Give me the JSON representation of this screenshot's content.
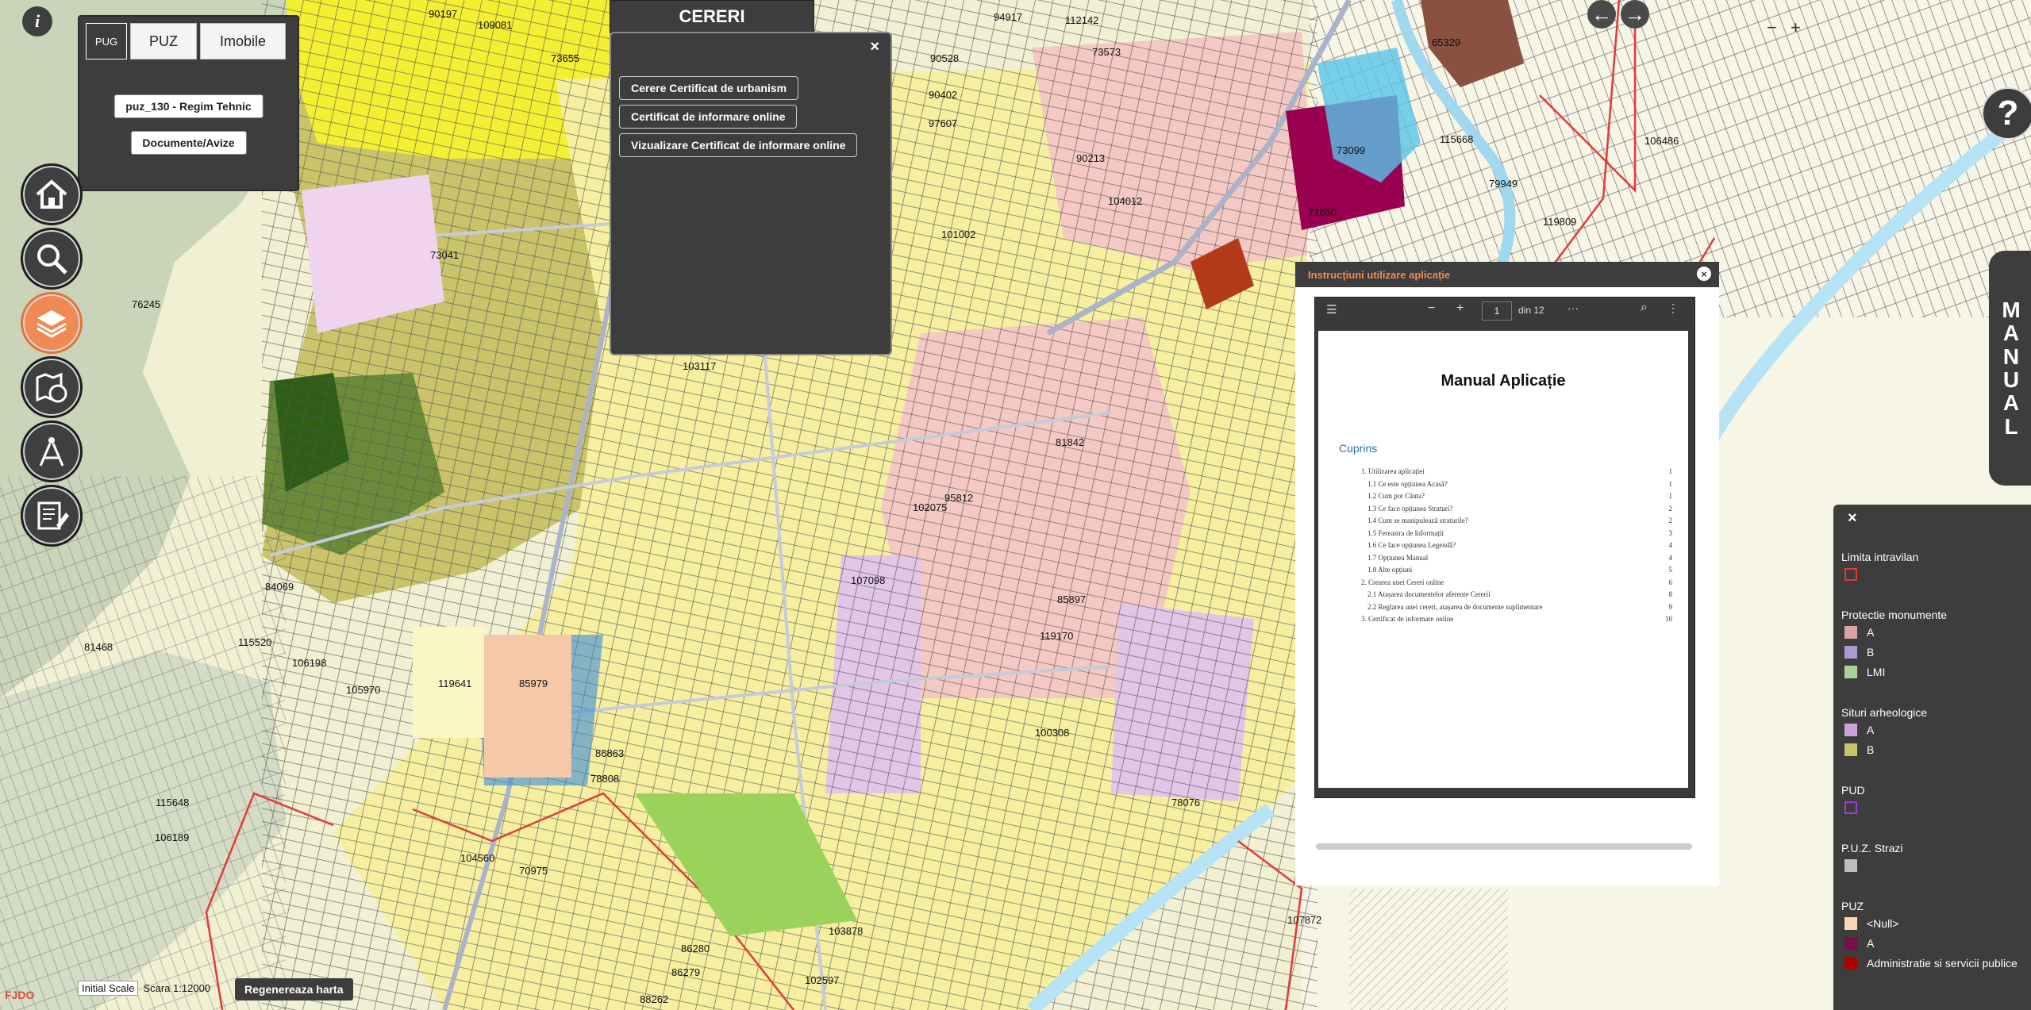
{
  "info_button": {
    "label": "i"
  },
  "tab_panel": {
    "tabs": [
      {
        "label": "PUG",
        "active": true
      },
      {
        "label": "PUZ",
        "active": false
      },
      {
        "label": "Imobile",
        "active": false
      }
    ],
    "buttons": [
      {
        "label": "puz_130 - Regim Tehnic"
      },
      {
        "label": "Documente/Avize"
      }
    ]
  },
  "left_toolbar": {
    "buttons": [
      {
        "icon": "home-icon",
        "active": false
      },
      {
        "icon": "search-icon",
        "active": false
      },
      {
        "icon": "layers-icon",
        "active": true
      },
      {
        "icon": "map-globe-icon",
        "active": false
      },
      {
        "icon": "compass-drafting-icon",
        "active": false
      },
      {
        "icon": "edit-document-icon",
        "active": false
      }
    ]
  },
  "cereri": {
    "title": "CERERI",
    "close_label": "×",
    "buttons": [
      {
        "label": "Cerere Certificat de urbanism"
      },
      {
        "label": "Certificat de informare online"
      },
      {
        "label": "Vizualizare Certificat de informare online"
      }
    ]
  },
  "nav": {
    "zoom_out": "−",
    "zoom_in": "+",
    "back": "←",
    "forward": "→"
  },
  "help_button": {
    "label": "?"
  },
  "manual_tab": {
    "label": "MANUAL"
  },
  "doc_window": {
    "title": "Instrucțiuni utilizare aplicație",
    "close_label": "×",
    "pdf_toolbar": {
      "page": "1",
      "total": "din 12",
      "zoom_out": "−",
      "zoom_in": "+",
      "more": "···"
    },
    "pdf_title": "Manual Aplicație",
    "toc_heading": "Cuprins",
    "toc": [
      {
        "text": "1. Utilizarea aplicației",
        "page": "1",
        "indent": 0
      },
      {
        "text": "1.1 Ce este opțiunea Acasă?",
        "page": "1",
        "indent": 1
      },
      {
        "text": "1.2 Cum pot Căuta?",
        "page": "1",
        "indent": 1
      },
      {
        "text": "1.3 Ce face opțiunea Straturi?",
        "page": "2",
        "indent": 1
      },
      {
        "text": "1.4 Cum se manipulează straturile?",
        "page": "2",
        "indent": 1
      },
      {
        "text": "1.5 Fereastra de Informații",
        "page": "3",
        "indent": 1
      },
      {
        "text": "1.6 Ce face opțiunea Legendă?",
        "page": "4",
        "indent": 1
      },
      {
        "text": "1.7 Opțiunea Manual",
        "page": "4",
        "indent": 1
      },
      {
        "text": "1.8 Alte opțiuni",
        "page": "5",
        "indent": 1
      },
      {
        "text": "2. Crearea unei Cereri online",
        "page": "6",
        "indent": 0
      },
      {
        "text": "2.1 Atașarea documentelor aferente Cererii",
        "page": "8",
        "indent": 1
      },
      {
        "text": "2.2 Reglarea unei cereri, atașarea de documente suplimentare",
        "page": "9",
        "indent": 1
      },
      {
        "text": "3. Certificat de informare online",
        "page": "10",
        "indent": 0
      }
    ]
  },
  "legend": {
    "close_label": "×",
    "groups": [
      {
        "title": "Limita intravilan",
        "items": [
          {
            "label": "",
            "color": "#e23a3a",
            "style": "outline"
          }
        ]
      },
      {
        "title": "Protectie monumente",
        "items": [
          {
            "label": "A",
            "color": "#d9a3a3",
            "style": "fill"
          },
          {
            "label": "B",
            "color": "#a99ad3",
            "style": "fill"
          },
          {
            "label": "LMI",
            "color": "#a9d39a",
            "style": "fill"
          }
        ]
      },
      {
        "title": "Situri arheologice",
        "items": [
          {
            "label": "A",
            "color": "#c9a3d9",
            "style": "fill"
          },
          {
            "label": "B",
            "color": "#c9c36a",
            "style": "fill"
          }
        ]
      },
      {
        "title": "PUD",
        "items": [
          {
            "label": "",
            "color": "#9a3dd9",
            "style": "outline"
          }
        ]
      },
      {
        "title": "P.U.Z. Strazi",
        "items": [
          {
            "label": "",
            "color": "#bdbdbd",
            "style": "fill"
          }
        ]
      },
      {
        "title": "PUZ",
        "items": [
          {
            "label": "<Null>",
            "color": "#f6d8b4",
            "style": "fill"
          },
          {
            "label": "A",
            "color": "#7a0e4a",
            "style": "fill"
          },
          {
            "label": "Administratie si servicii publice",
            "color": "#b00000",
            "style": "fill"
          }
        ]
      }
    ]
  },
  "bottom_bar": {
    "scale_select": "Initial Scale",
    "scale_text": "Scara 1:12000",
    "regen_label": "Regenereaza harta",
    "logo": "FJDO"
  },
  "map": {
    "colors": {
      "background": "#f1f0d2",
      "forest": "#c9d4b8",
      "residential": "#f5ef9f",
      "commercial": "#f5c9c3",
      "historic": "#e2c6e8",
      "agricultural": "#c9c36a",
      "road": "#aab3c9",
      "water": "#b6e3f5",
      "limit": "#e23a3a"
    },
    "parcel_labels": [
      "90197",
      "109081",
      "73655",
      "94917",
      "112142",
      "73573",
      "90528",
      "90402",
      "97607",
      "90213",
      "104012",
      "101002",
      "73041",
      "76245",
      "103117",
      "81842",
      "102075",
      "95812",
      "107098",
      "85897",
      "119170",
      "84069",
      "81468",
      "115520",
      "106198",
      "105970",
      "119641",
      "85979",
      "86863",
      "78808",
      "115648",
      "106189",
      "104560",
      "70975",
      "86280",
      "86279",
      "88262",
      "103878",
      "102597",
      "100308",
      "78076",
      "107872",
      "115668",
      "106486",
      "119809",
      "79949",
      "71650",
      "73099",
      "65329"
    ]
  }
}
